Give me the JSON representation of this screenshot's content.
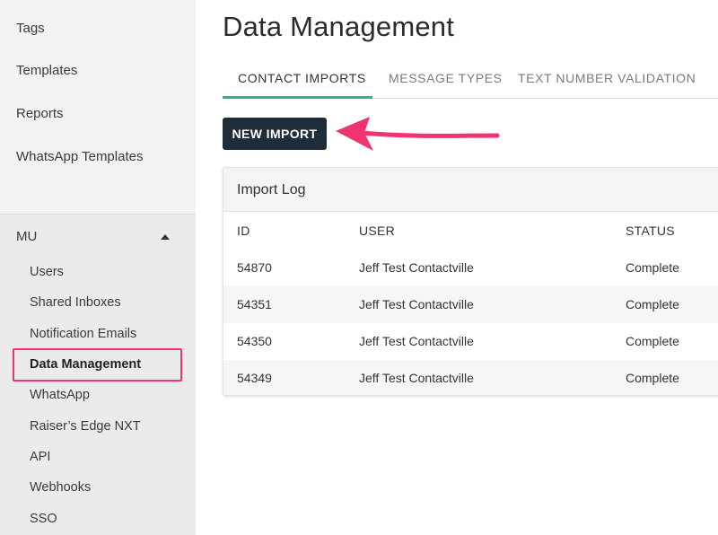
{
  "sidebar": {
    "top_items": [
      "Tags",
      "Templates",
      "Reports",
      "WhatsApp Templates"
    ],
    "section": {
      "label": "MU",
      "items": [
        "Users",
        "Shared Inboxes",
        "Notification Emails",
        "Data Management",
        "WhatsApp",
        "Raiser’s Edge NXT",
        "API",
        "Webhooks",
        "SSO"
      ],
      "active_item": "Data Management"
    }
  },
  "main": {
    "title": "Data Management",
    "tabs": [
      {
        "label": "CONTACT IMPORTS",
        "active": true
      },
      {
        "label": "MESSAGE TYPES",
        "active": false
      },
      {
        "label": "TEXT NUMBER VALIDATION",
        "active": false
      }
    ],
    "new_import_label": "NEW IMPORT",
    "import_log": {
      "title": "Import Log",
      "columns": [
        "ID",
        "USER",
        "STATUS"
      ],
      "rows": [
        {
          "id": "54870",
          "user": "Jeff Test Contactville",
          "status": "Complete"
        },
        {
          "id": "54351",
          "user": "Jeff Test Contactville",
          "status": "Complete"
        },
        {
          "id": "54350",
          "user": "Jeff Test Contactville",
          "status": "Complete"
        },
        {
          "id": "54349",
          "user": "Jeff Test Contactville",
          "status": "Complete"
        }
      ]
    }
  },
  "colors": {
    "accent_tab": "#2bb38a",
    "button_bg": "#1f2d3a",
    "annotation": "#f0356e"
  },
  "icons": {
    "section_toggle": "caret-up-icon",
    "annotation_arrow": "arrow-left-icon"
  }
}
